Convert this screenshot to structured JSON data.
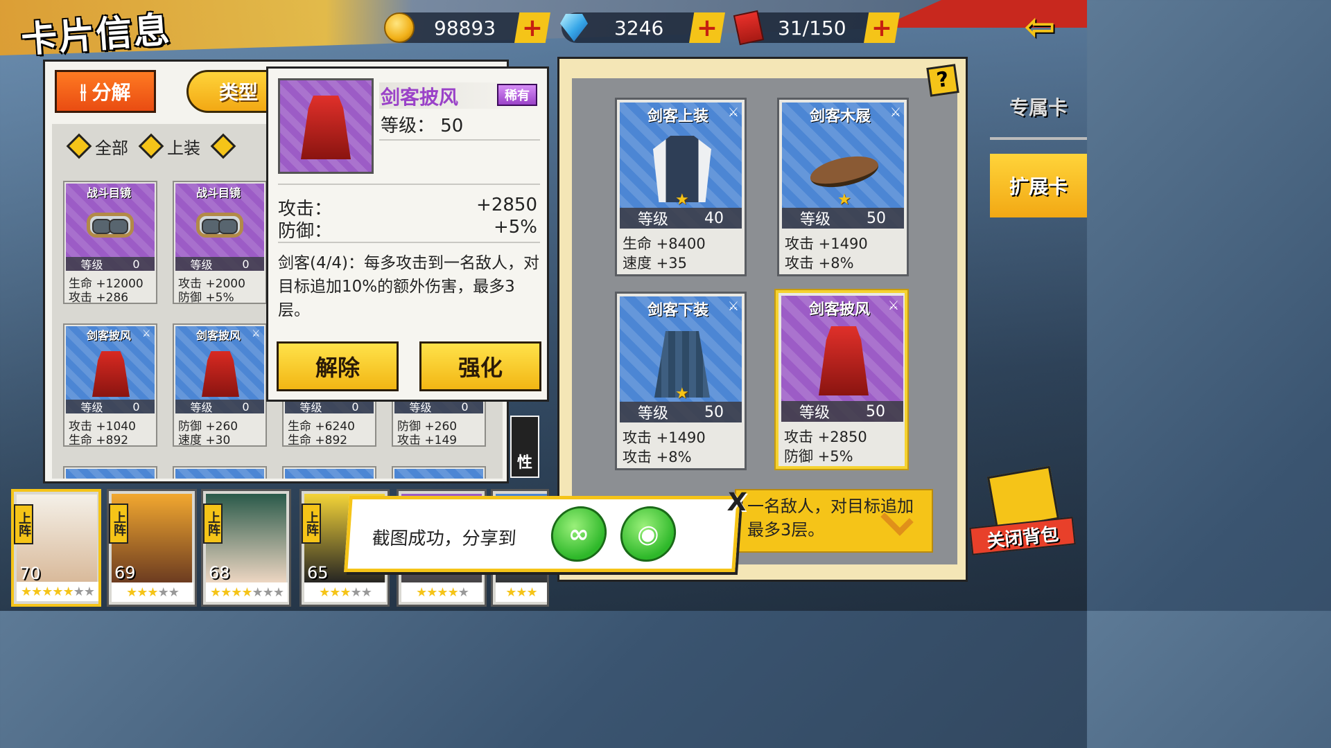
{
  "page": {
    "title": "卡片信息"
  },
  "currencies": {
    "gold": {
      "value": "98893",
      "icon": "gold-coin-icon"
    },
    "diamond": {
      "value": "3246",
      "icon": "diamond-icon"
    },
    "stamina": {
      "value": "31/150",
      "icon": "stamina-ticket-icon"
    },
    "plus": "+"
  },
  "left_panel": {
    "decompose_label": "分解",
    "type_label": "类型",
    "filters": [
      "全部",
      "上装"
    ],
    "cards": [
      {
        "name": "战斗目镜",
        "level_label": "等级",
        "level": "0",
        "stat1": "生命 +12000",
        "stat2": "攻击 +286"
      },
      {
        "name": "战斗目镜",
        "level_label": "等级",
        "level": "0",
        "stat1": "攻击 +2000",
        "stat2": "防御 +5%"
      },
      {
        "name": "剑客披风",
        "level_label": "等级",
        "level": "0",
        "stat1": "攻击 +1040",
        "stat2": "生命 +892"
      },
      {
        "name": "剑客披风",
        "level_label": "等级",
        "level": "0",
        "stat1": "防御 +260",
        "stat2": "速度 +30"
      },
      {
        "name": "",
        "level_label": "等级",
        "level": "0",
        "stat1": "生命 +6240",
        "stat2": "生命 +892"
      },
      {
        "name": "",
        "level_label": "等级",
        "level": "0",
        "stat1": "防御 +260",
        "stat2": "攻击 +149"
      }
    ]
  },
  "detail": {
    "name": "剑客披风",
    "rarity": "稀有",
    "level": "等级： 50",
    "stats": [
      {
        "label": "攻击：",
        "value": "+2850"
      },
      {
        "label": "防御：",
        "value": "+5%"
      }
    ],
    "description": "剑客(4/4)：每多攻击到一名敌人，对目标追加10%的额外伤害，最多3层。",
    "buttons": {
      "remove": "解除",
      "enhance": "强化"
    }
  },
  "equipped": {
    "level_label": "等级",
    "cards": [
      {
        "name": "剑客上装",
        "level": "40",
        "stat1": "生命 +8400",
        "stat2": "速度 +35"
      },
      {
        "name": "剑客木屐",
        "level": "50",
        "stat1": "攻击 +1490",
        "stat2": "攻击 +8%"
      },
      {
        "name": "剑客下装",
        "level": "50",
        "stat1": "攻击 +1490",
        "stat2": "攻击 +8%"
      },
      {
        "name": "剑客披风",
        "level": "50",
        "stat1": "攻击 +2850",
        "stat2": "防御 +5%"
      }
    ],
    "skill_preview": "一名敌人，对目标追加最多3层。"
  },
  "side_tabs": {
    "exclusive": "专属卡",
    "extension": "扩展卡",
    "close_bag": "关闭背包"
  },
  "attr_label": "性",
  "heroes": [
    {
      "tag": "上阵",
      "level": "70",
      "stars": 5
    },
    {
      "tag": "上阵",
      "level": "69",
      "stars": 3
    },
    {
      "tag": "上阵",
      "level": "68",
      "stars": 4
    },
    {
      "tag": "上阵",
      "level": "65",
      "stars": 3
    },
    {
      "tag": "",
      "level": "",
      "stars": 4
    },
    {
      "tag": "",
      "level": "",
      "stars": 3
    }
  ],
  "share": {
    "text": "截图成功，分享到",
    "close": "X",
    "wechat_icon": "wechat-icon",
    "moments_icon": "moments-icon"
  },
  "colors": {
    "accent_yellow": "#f5c418",
    "accent_orange": "#e94c12",
    "rare_purple": "#9a42c8",
    "blue_card": "#4c86d4"
  }
}
